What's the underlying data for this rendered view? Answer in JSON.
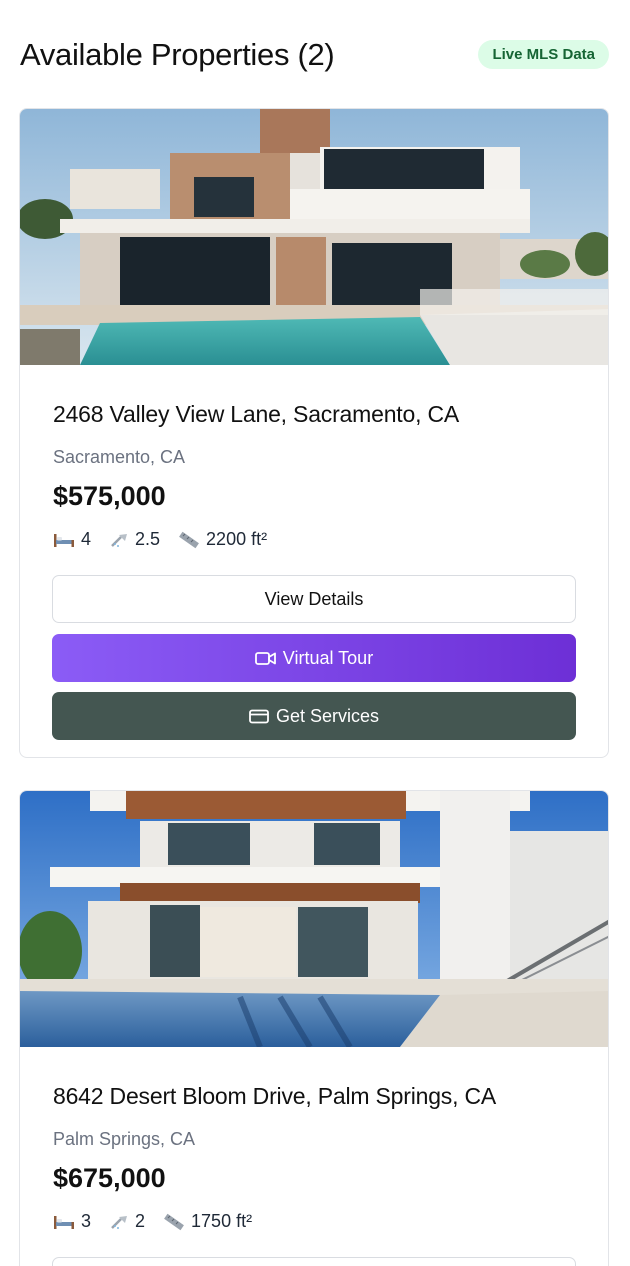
{
  "header": {
    "title": "Available Properties (2)",
    "badge": "Live MLS Data"
  },
  "properties": [
    {
      "address": "2468 Valley View Lane, Sacramento, CA",
      "city": "Sacramento, CA",
      "price": "$575,000",
      "beds": "4",
      "baths": "2.5",
      "sqft": "2200 ft²",
      "buttons": {
        "details": "View Details",
        "tour": "Virtual Tour",
        "services": "Get Services"
      }
    },
    {
      "address": "8642 Desert Bloom Drive, Palm Springs, CA",
      "city": "Palm Springs, CA",
      "price": "$675,000",
      "beds": "3",
      "baths": "2",
      "sqft": "1750 ft²"
    }
  ],
  "colors": {
    "badge_bg": "#dcfce7",
    "badge_text": "#166534",
    "tour_gradient_start": "#8b5cf6",
    "tour_gradient_end": "#6d2fd6",
    "services_bg": "#445651",
    "muted_text": "#6b7280"
  },
  "icons": {
    "beds": "bed-icon",
    "baths": "shower-icon",
    "area": "ruler-icon",
    "tour": "video-camera-icon",
    "services": "credit-card-icon"
  }
}
